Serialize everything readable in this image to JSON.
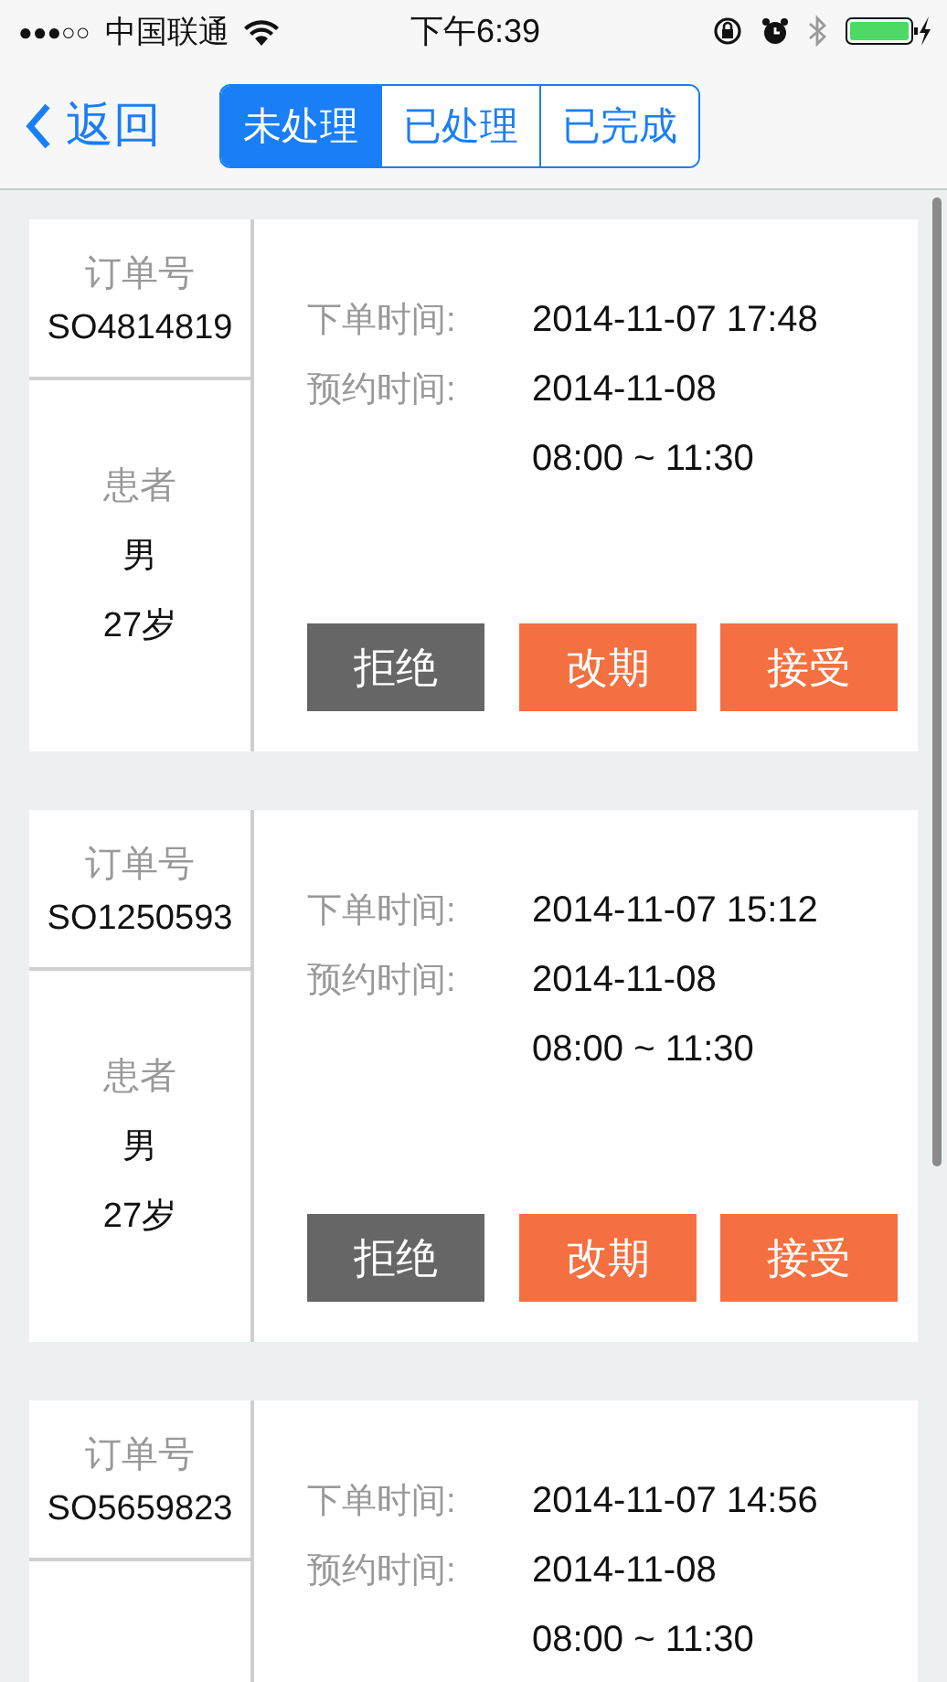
{
  "status_bar": {
    "signal": "●●●○○",
    "carrier": "中国联通",
    "time": "下午6:39"
  },
  "nav": {
    "back": "返回",
    "tabs": [
      {
        "label": "未处理",
        "selected": true
      },
      {
        "label": "已处理",
        "selected": false
      },
      {
        "label": "已完成",
        "selected": false
      }
    ]
  },
  "orders": [
    {
      "order_label": "订单号",
      "order_no": "SO4814819",
      "patient_label": "患者",
      "gender": "男",
      "age": "27岁",
      "order_time_label": "下单时间:",
      "order_time": "2014-11-07 17:48",
      "appointment_label": "预约时间:",
      "appointment_date": "2014-11-08",
      "appointment_slot": "08:00 ~ 11:30",
      "actions": [
        {
          "label": "拒绝",
          "kind": "reject"
        },
        {
          "label": "改期",
          "kind": "reschedule"
        },
        {
          "label": "接受",
          "kind": "accept"
        }
      ]
    },
    {
      "order_label": "订单号",
      "order_no": "SO1250593",
      "patient_label": "患者",
      "gender": "男",
      "age": "27岁",
      "order_time_label": "下单时间:",
      "order_time": "2014-11-07 15:12",
      "appointment_label": "预约时间:",
      "appointment_date": "2014-11-08",
      "appointment_slot": "08:00 ~ 11:30",
      "actions": [
        {
          "label": "拒绝",
          "kind": "reject"
        },
        {
          "label": "改期",
          "kind": "reschedule"
        },
        {
          "label": "接受",
          "kind": "accept"
        }
      ]
    },
    {
      "order_label": "订单号",
      "order_no": "SO5659823",
      "order_time_label": "下单时间:",
      "order_time": "2014-11-07 14:56",
      "appointment_label": "预约时间:",
      "appointment_date": "2014-11-08",
      "appointment_slot": "08:00 ~ 11:30"
    }
  ]
}
